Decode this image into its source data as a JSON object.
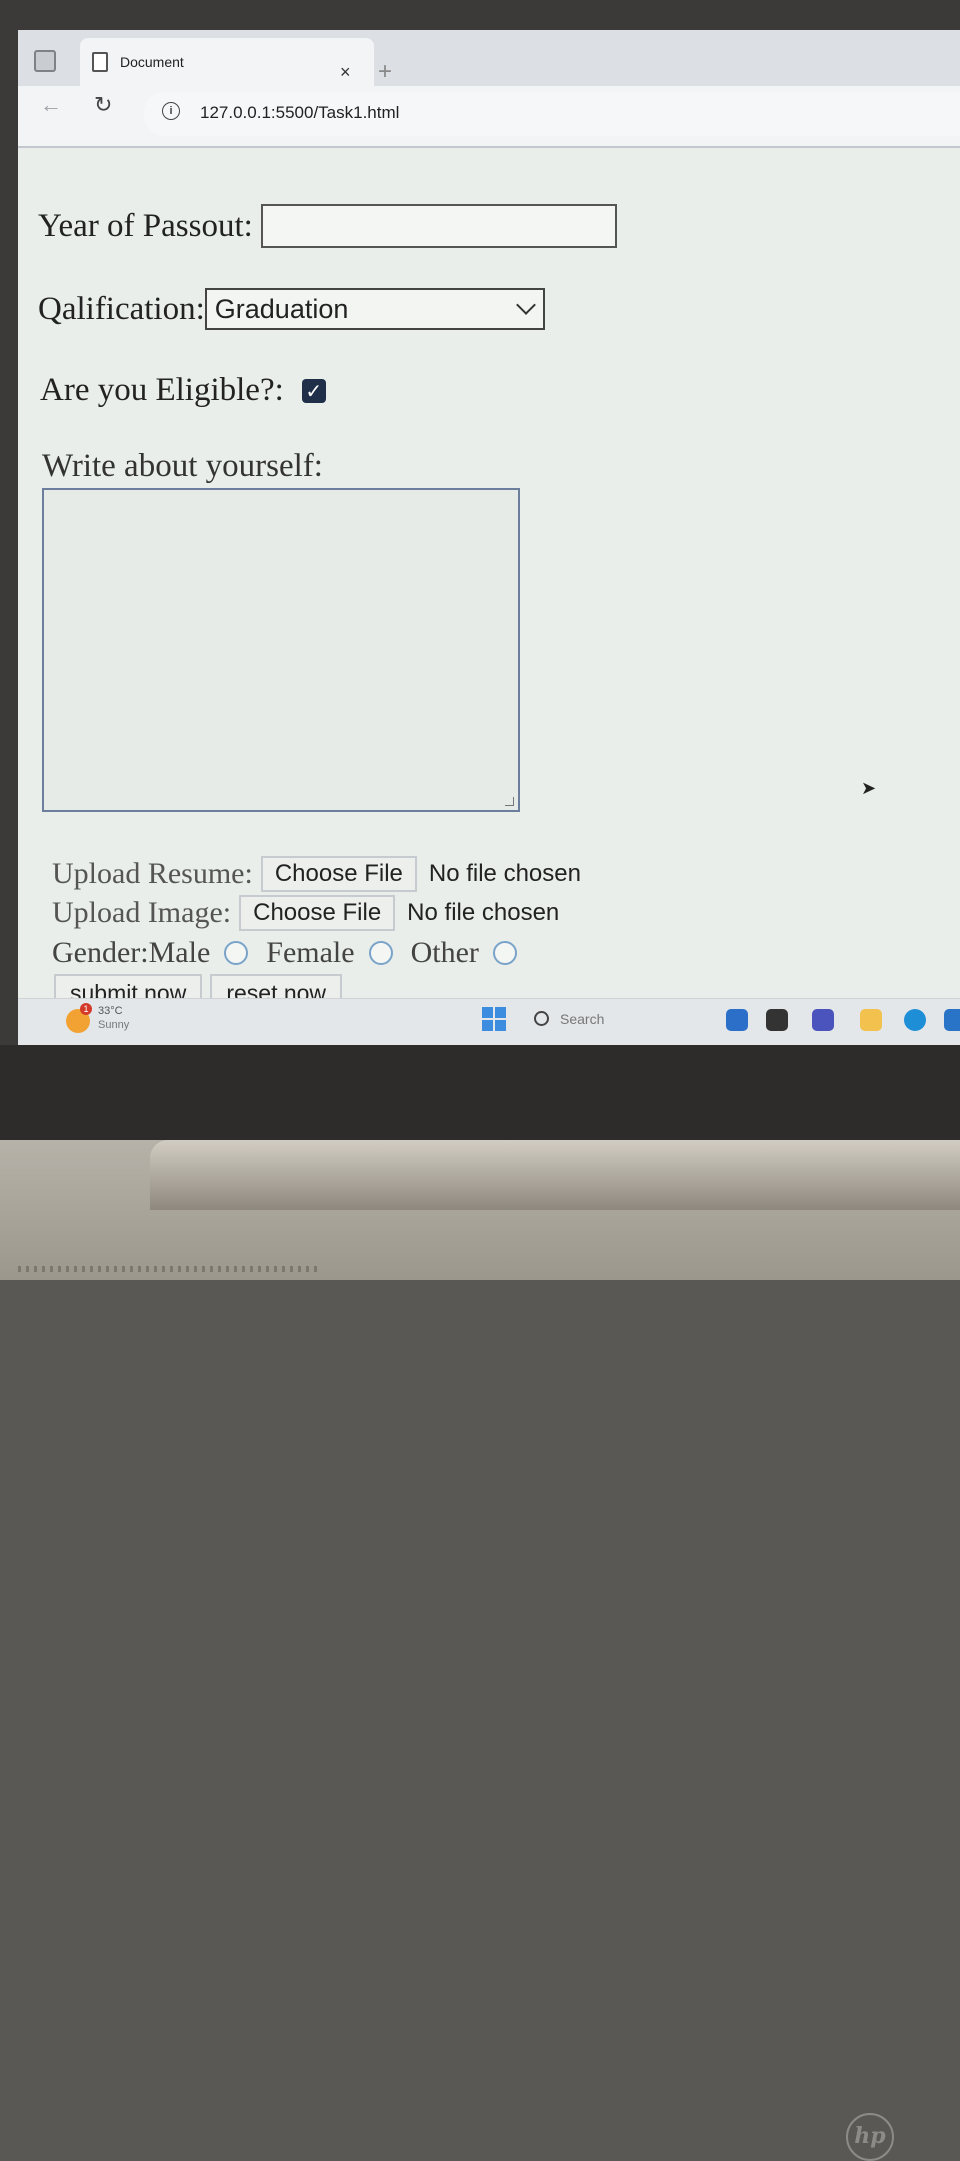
{
  "browser": {
    "tab_title": "Document",
    "tab_close": "×",
    "new_tab": "+",
    "url": "127.0.0.1:5500/Task1.html"
  },
  "form": {
    "year_label": "Year of Passout:",
    "year_value": "",
    "qualification_label": "Qalification:",
    "qualification_selected": "Graduation",
    "eligible_label": "Are you Eligible?:",
    "eligible_checked": true,
    "about_label": "Write about yourself:",
    "about_value": "",
    "resume_label": "Upload Resume:",
    "resume_button": "Choose File",
    "resume_status": "No file chosen",
    "image_label": "Upload Image:",
    "image_button": "Choose File",
    "image_status": "No file chosen",
    "gender_label": "Gender:",
    "gender_options": [
      "Male",
      "Female",
      "Other"
    ],
    "submit_label": "submit now",
    "reset_label": "reset now"
  },
  "taskbar": {
    "weather_badge": "1",
    "temperature": "33°C",
    "condition": "Sunny",
    "search_placeholder": "Search"
  },
  "device": {
    "logo": "hp"
  },
  "icons": [
    "window-icon",
    "document-icon",
    "close-icon",
    "plus-icon",
    "back-icon",
    "reload-icon",
    "info-icon",
    "chevron-down-icon",
    "checkmark-icon",
    "windows-start-icon",
    "search-icon",
    "cursor-icon"
  ]
}
